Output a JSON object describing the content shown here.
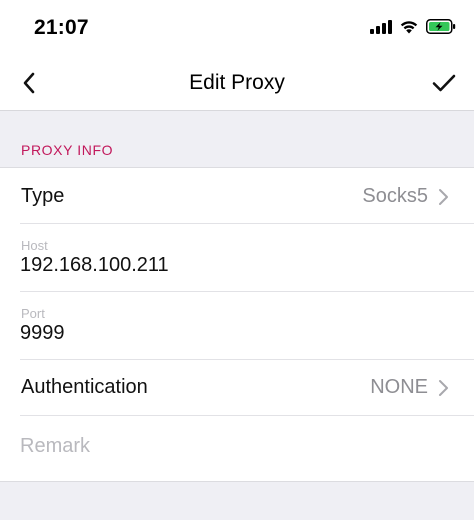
{
  "status_bar": {
    "time": "21:07",
    "icons": [
      "signal-icon",
      "wifi-icon",
      "battery-charging-icon"
    ],
    "battery_color": "#34c759"
  },
  "nav": {
    "title": "Edit Proxy",
    "back_icon": "chevron-left-icon",
    "done_icon": "checkmark-icon"
  },
  "section": {
    "header": "PROXY INFO",
    "header_color": "#c2185b"
  },
  "form": {
    "type": {
      "label": "Type",
      "value": "Socks5"
    },
    "host": {
      "caption": "Host",
      "value": "192.168.100.211"
    },
    "port": {
      "caption": "Port",
      "value": "9999"
    },
    "authentication": {
      "label": "Authentication",
      "value": "NONE"
    },
    "remark": {
      "placeholder": "Remark",
      "value": ""
    }
  }
}
